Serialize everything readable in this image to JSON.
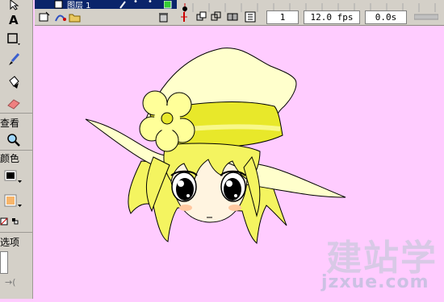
{
  "timeline": {
    "layer_name": "图层 1",
    "current_frame": "1",
    "frame_rate": "12.0 fps",
    "elapsed_time": "0.0s"
  },
  "tools": {
    "section_view": "查看",
    "section_colors": "颜色",
    "section_options": "选项",
    "stroke_color": "#000000",
    "fill_color": "#f7b56b"
  },
  "watermark": {
    "text_cn": "建站学",
    "text_url": "jzxue.com"
  },
  "colors": {
    "stage_bg": "#ffccff",
    "hat": "#ffffcc",
    "hat_band": "#e8e82a",
    "hair": "#f4f460",
    "skin": "#fff4e0"
  }
}
